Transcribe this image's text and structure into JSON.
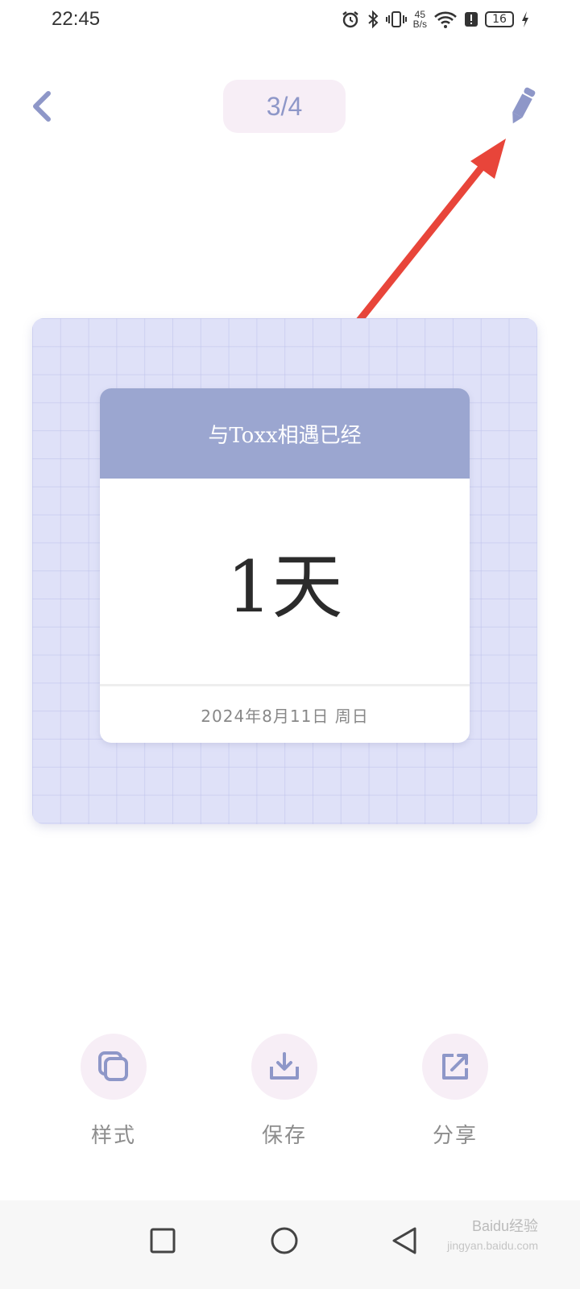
{
  "status_bar": {
    "time": "22:45",
    "net_speed_value": "45",
    "net_speed_unit": "B/s",
    "battery": "16",
    "icons": [
      "alarm-icon",
      "bluetooth-icon",
      "vibrate-icon",
      "wifi-icon",
      "alert-icon",
      "battery-icon",
      "charging-icon"
    ]
  },
  "nav": {
    "page_indicator": "3/4",
    "back_icon": "chevron-left-icon",
    "edit_icon": "pencil-icon"
  },
  "card": {
    "header": "与Toxx相遇已经",
    "count": "1天",
    "date": "2024年8月11日  周日"
  },
  "actions": [
    {
      "label": "样式",
      "icon": "layers-icon"
    },
    {
      "label": "保存",
      "icon": "download-icon"
    },
    {
      "label": "分享",
      "icon": "share-icon"
    }
  ],
  "watermark": {
    "brand": "Baidu经验",
    "url": "jingyan.baidu.com"
  },
  "colors": {
    "accent": "#8e97c8",
    "pill_bg": "#f7eef6",
    "card_header": "#9ba6d0",
    "preview_bg": "#dfe1f8",
    "annotation_arrow": "#e8453a"
  }
}
